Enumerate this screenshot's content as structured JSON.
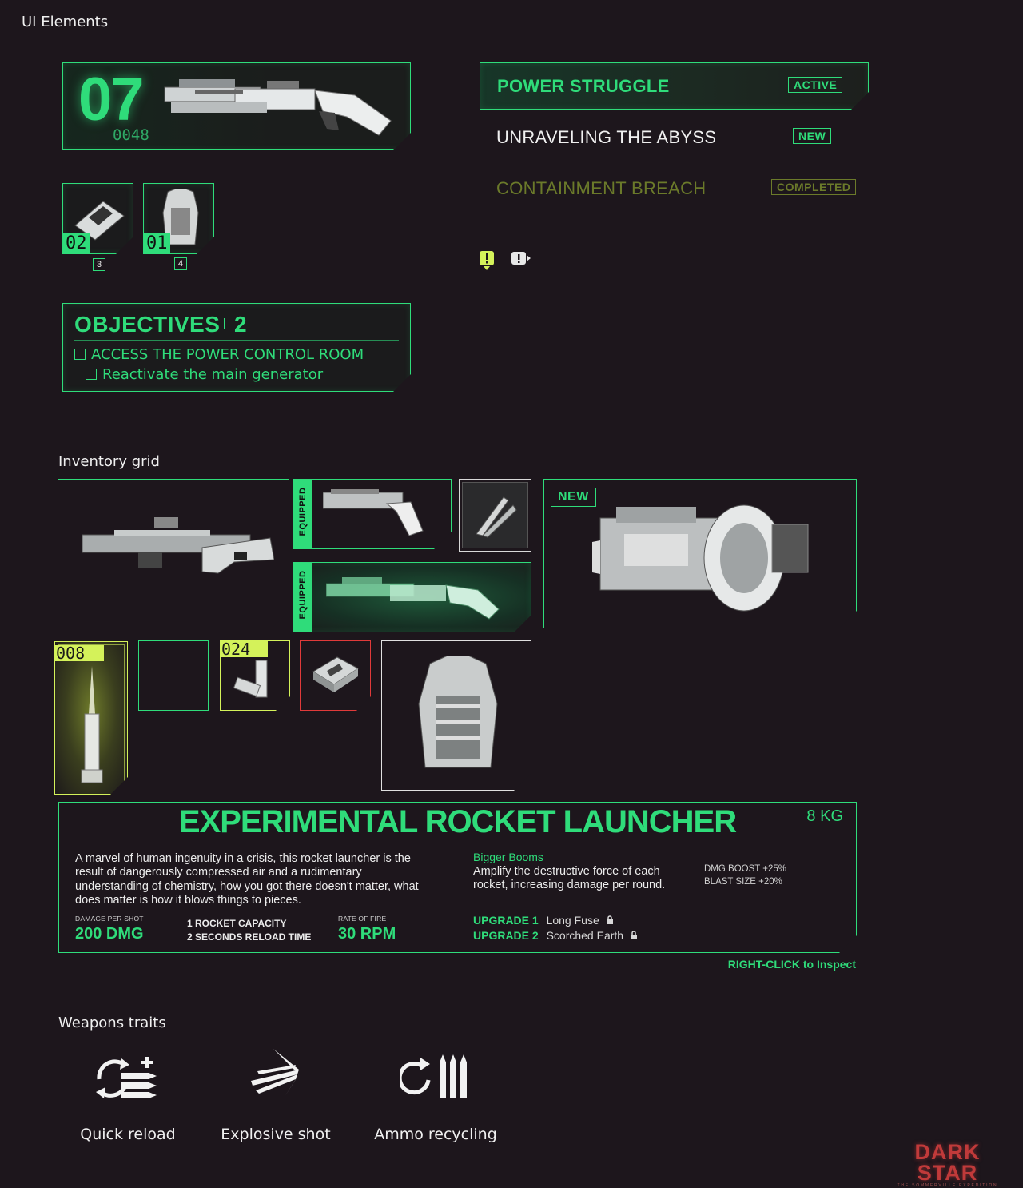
{
  "sections": {
    "ui_elements": "UI Elements",
    "inventory_grid": "Inventory grid",
    "weapons_traits": "Weapons traits"
  },
  "ammo_hud": {
    "clip": "07",
    "reserve": "0048"
  },
  "quick_slots": [
    {
      "count": "02",
      "key": "3"
    },
    {
      "count": "01",
      "key": "4"
    }
  ],
  "objectives": {
    "title": "OBJECTIVES",
    "count": "2",
    "items": [
      "ACCESS THE POWER CONTROL ROOM",
      "Reactivate the main generator"
    ]
  },
  "quests": [
    {
      "title": "POWER STRUGGLE",
      "status": "ACTIVE"
    },
    {
      "title": "UNRAVELING THE ABYSS",
      "status": "NEW"
    },
    {
      "title": "CONTAINMENT BREACH",
      "status": "COMPLETED"
    }
  ],
  "inventory": {
    "equipped_label": "EQUIPPED",
    "new_label": "NEW",
    "ammo_count_1": "008",
    "ammo_count_2": "024"
  },
  "item_detail": {
    "name": "EXPERIMENTAL ROCKET LAUNCHER",
    "weight": "8 KG",
    "description": "A marvel of human ingenuity in a crisis, this rocket launcher is the result of dangerously compressed air and a rudimentary understanding of chemistry, how you got there doesn't matter, what does matter is how it blows things to pieces.",
    "damage_label": "DAMAGE PER SHOT",
    "damage_value": "200 DMG",
    "capacity_line1": "1 ROCKET CAPACITY",
    "capacity_line2": "2 SECONDS RELOAD TIME",
    "rof_label": "RATE OF FIRE",
    "rof_value": "30 RPM",
    "perk_title": "Bigger Booms",
    "perk_desc": "Amplify the destructive force of each rocket, increasing damage per round.",
    "dmg_boost": "DMG BOOST +25%",
    "blast_size": "BLAST SIZE +20%",
    "upgrades": [
      {
        "label": "UPGRADE 1",
        "name": "Long Fuse"
      },
      {
        "label": "UPGRADE 2",
        "name": "Scorched Earth"
      }
    ],
    "inspect_hint": "RIGHT-CLICK to Inspect"
  },
  "traits": [
    {
      "label": "Quick reload",
      "icon": "quick-reload-icon"
    },
    {
      "label": "Explosive shot",
      "icon": "explosive-shot-icon"
    },
    {
      "label": "Ammo recycling",
      "icon": "ammo-recycling-icon"
    }
  ],
  "logo": {
    "title": "DARK STAR",
    "subtitle": "THE SOMMERVILLE EXPEDITION"
  },
  "colors": {
    "accent": "#2fdc7a",
    "background": "#1d161c",
    "completed": "#6b7a2a",
    "highlight": "#d4f25a",
    "warning": "#e03a3a"
  }
}
